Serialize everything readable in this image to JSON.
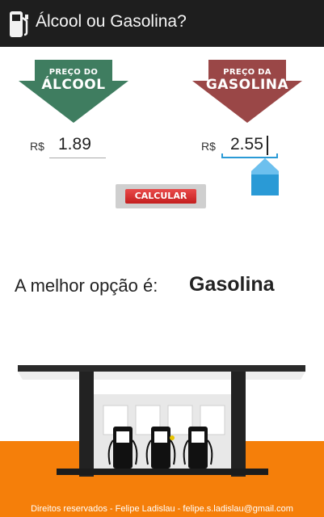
{
  "app": {
    "title": "Álcool ou Gasolina?",
    "icon": "gas-pump-icon"
  },
  "alcool": {
    "arrow_line1": "PREÇO DO",
    "arrow_line2": "ÁLCOOL",
    "currency": "R$",
    "value": "1.89",
    "arrow_color": "#3f7d60"
  },
  "gasolina": {
    "arrow_line1": "PREÇO DA",
    "arrow_line2": "GASOLINA",
    "currency": "R$",
    "value": "2.55",
    "arrow_color": "#9a4747"
  },
  "button": {
    "label": "CALCULAR"
  },
  "result": {
    "label": "A melhor opção é:",
    "value": "Gasolina"
  },
  "footer": {
    "text": "Direitos reservados - Felipe Ladislau - felipe.s.ladislau@gmail.com"
  },
  "colors": {
    "action_bar": "#1e1e1e",
    "ground": "#f57f0a",
    "button": "#d42b2b",
    "focus": "#2a9ad6"
  }
}
